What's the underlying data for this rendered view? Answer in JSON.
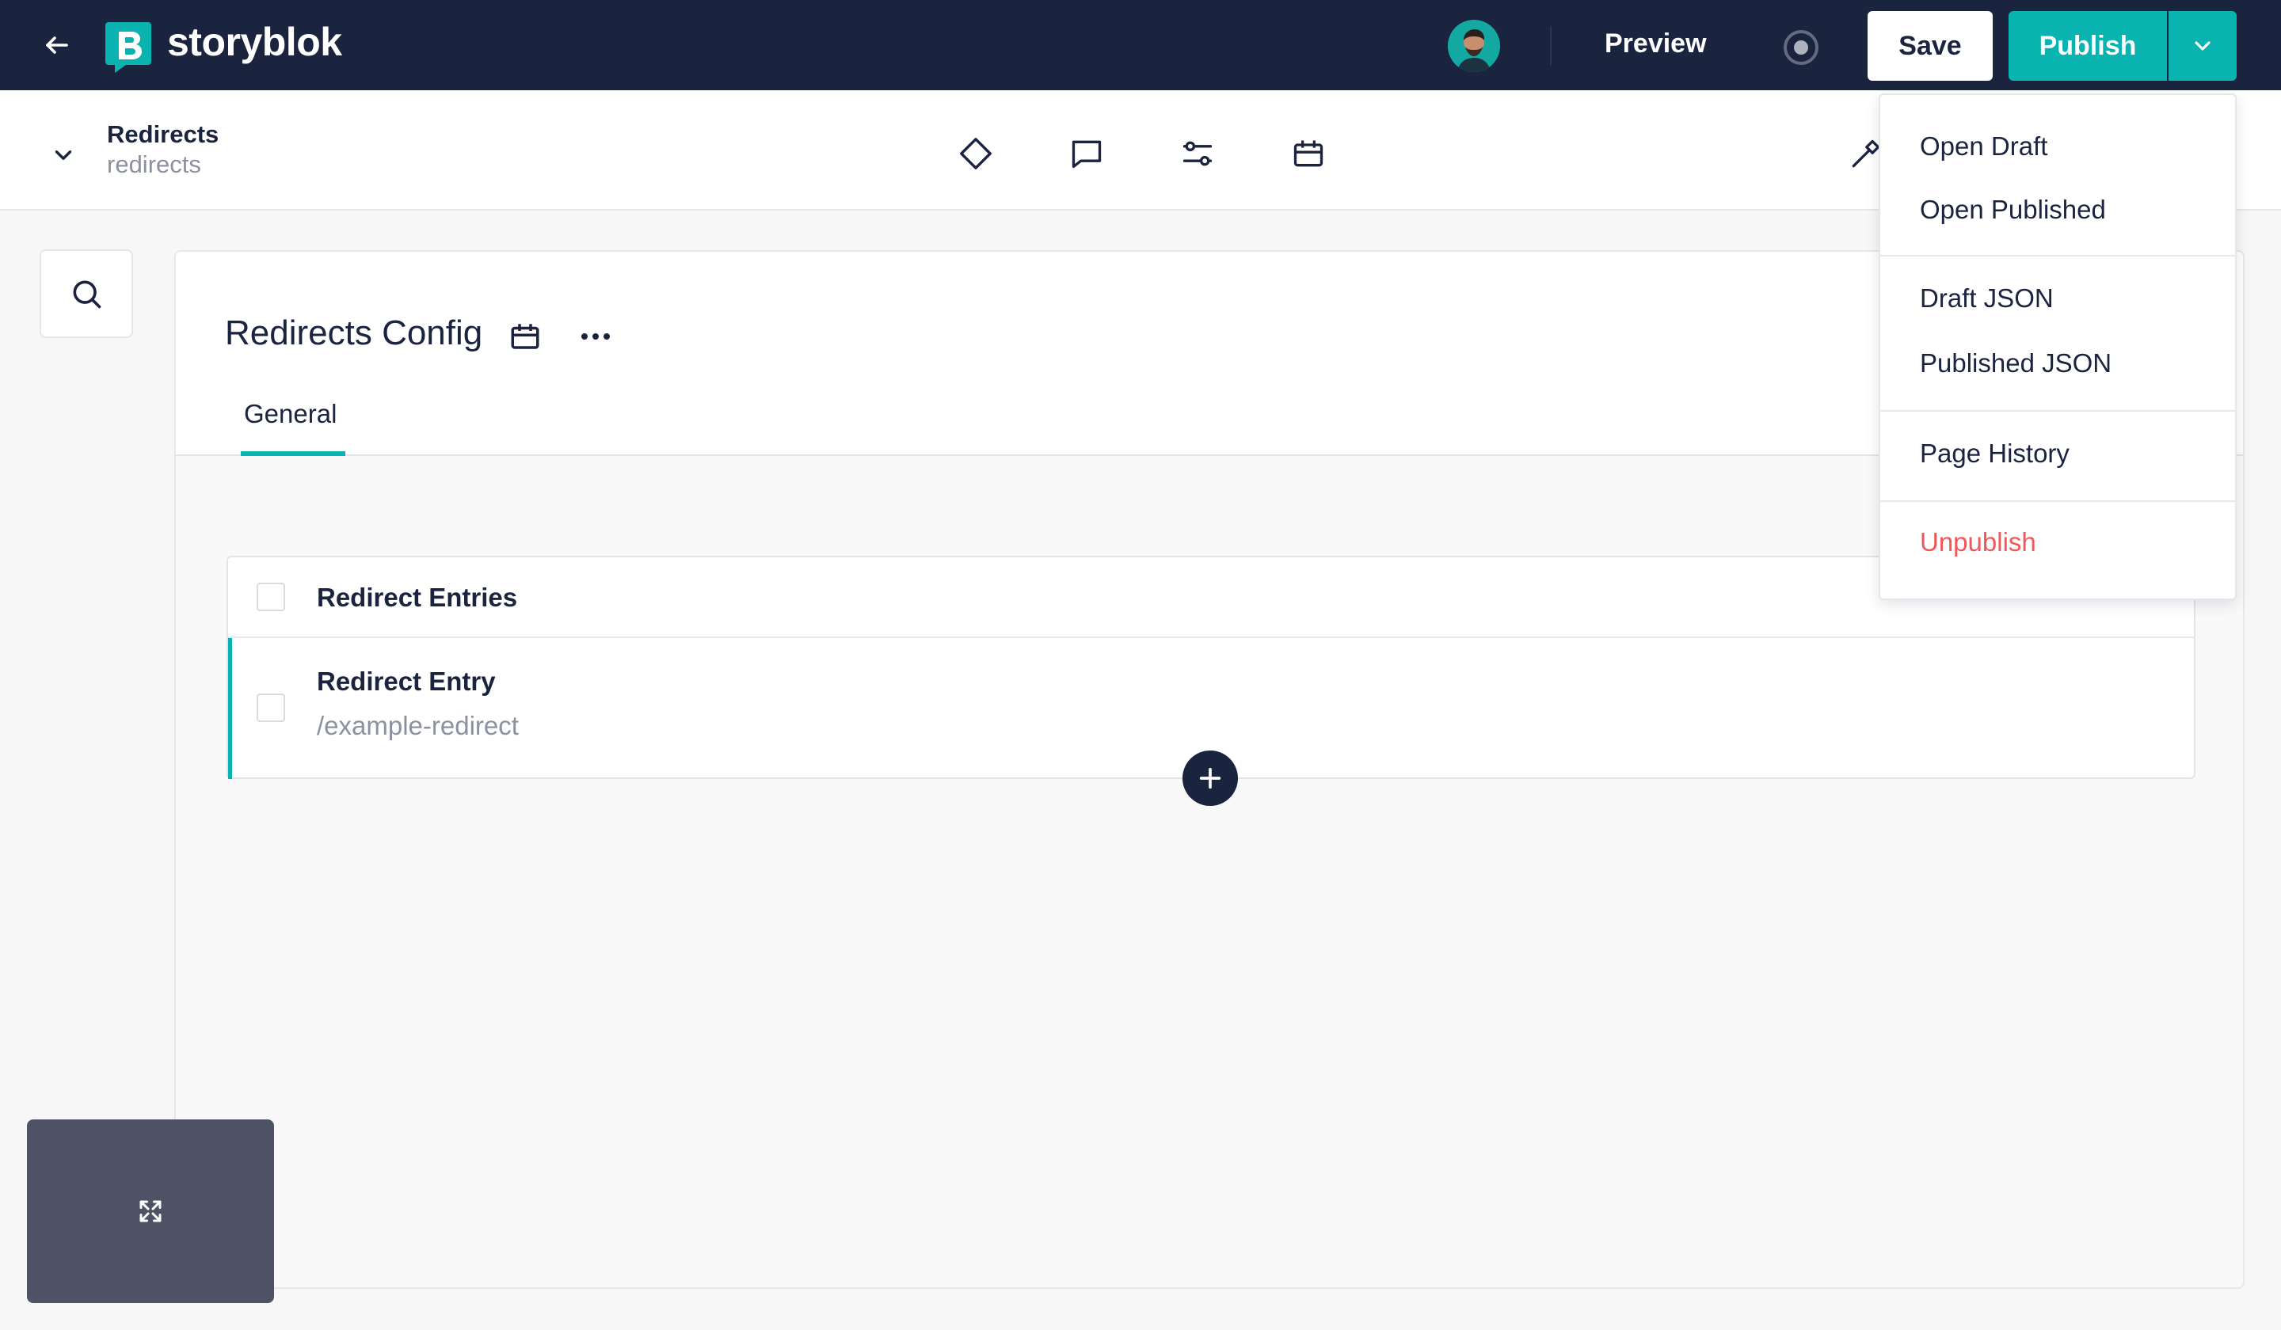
{
  "app": {
    "brand": "storyblok",
    "colors": {
      "topbar": "#1b243f",
      "accent": "#09b3af",
      "danger": "#f25757"
    }
  },
  "topbar": {
    "preview_label": "Preview",
    "save_label": "Save",
    "publish_label": "Publish"
  },
  "story": {
    "title": "Redirects",
    "slug": "redirects"
  },
  "toolbar": {
    "icons": [
      "diamond-icon",
      "comment-icon",
      "settings-sliders-icon",
      "calendar-icon",
      "hammer-icon"
    ]
  },
  "block": {
    "title": "Redirects Config",
    "tabs": [
      {
        "label": "General"
      }
    ]
  },
  "entries": {
    "header": "Redirect Entries",
    "items": [
      {
        "title": "Redirect Entry",
        "subtitle": "/example-redirect"
      }
    ]
  },
  "menu": {
    "items": [
      {
        "label": "Open Draft"
      },
      {
        "label": "Open Published"
      },
      {
        "label": "Draft JSON"
      },
      {
        "label": "Published JSON"
      },
      {
        "label": "Page History"
      },
      {
        "label": "Unpublish"
      }
    ]
  }
}
